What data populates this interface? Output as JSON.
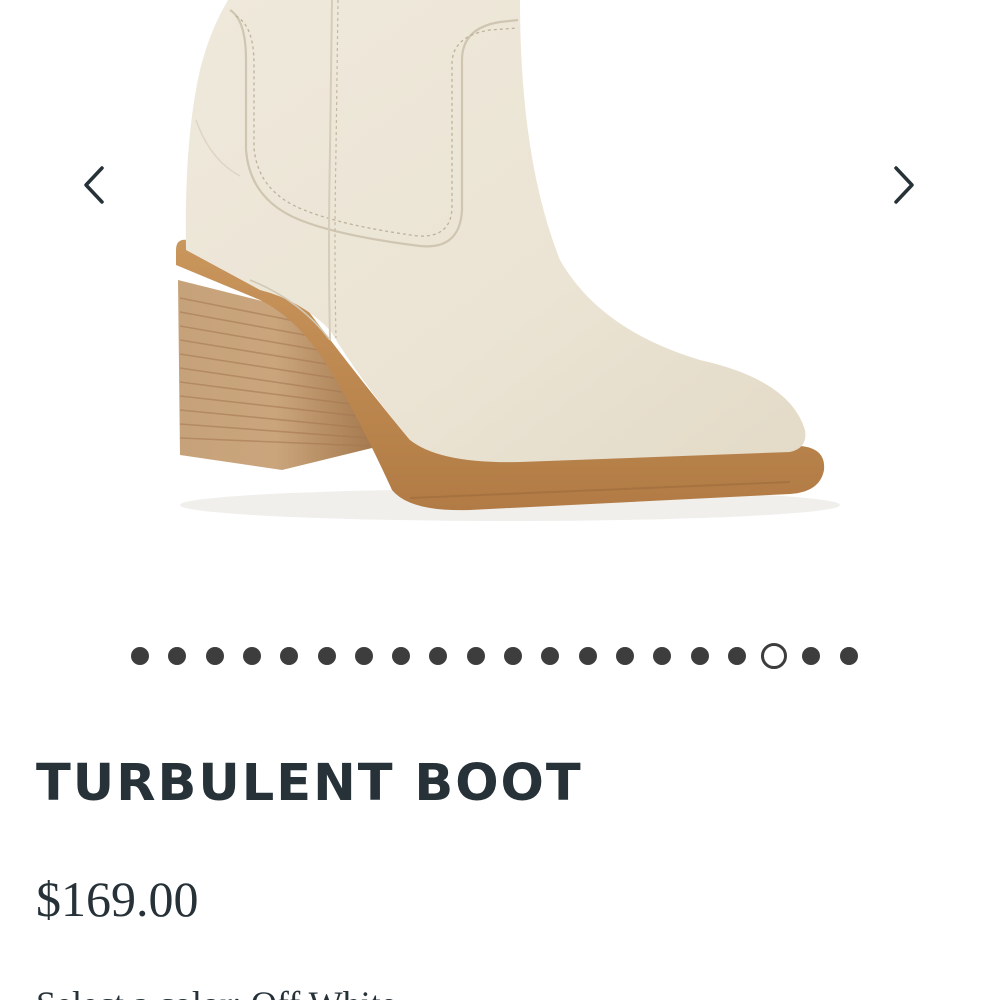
{
  "gallery": {
    "image": "product-boot-image",
    "prev_icon": "chevron-left-icon",
    "next_icon": "chevron-right-icon",
    "dot_count": 20,
    "active_index": 17,
    "dot_color": "#3d3d3d"
  },
  "product": {
    "title": "TURBULENT BOOT",
    "price": "$169.00",
    "color_label": "Select a color: Off White"
  },
  "colors": {
    "text": "#263238",
    "leather": "#ece5d6",
    "sole": "#c48e55"
  }
}
